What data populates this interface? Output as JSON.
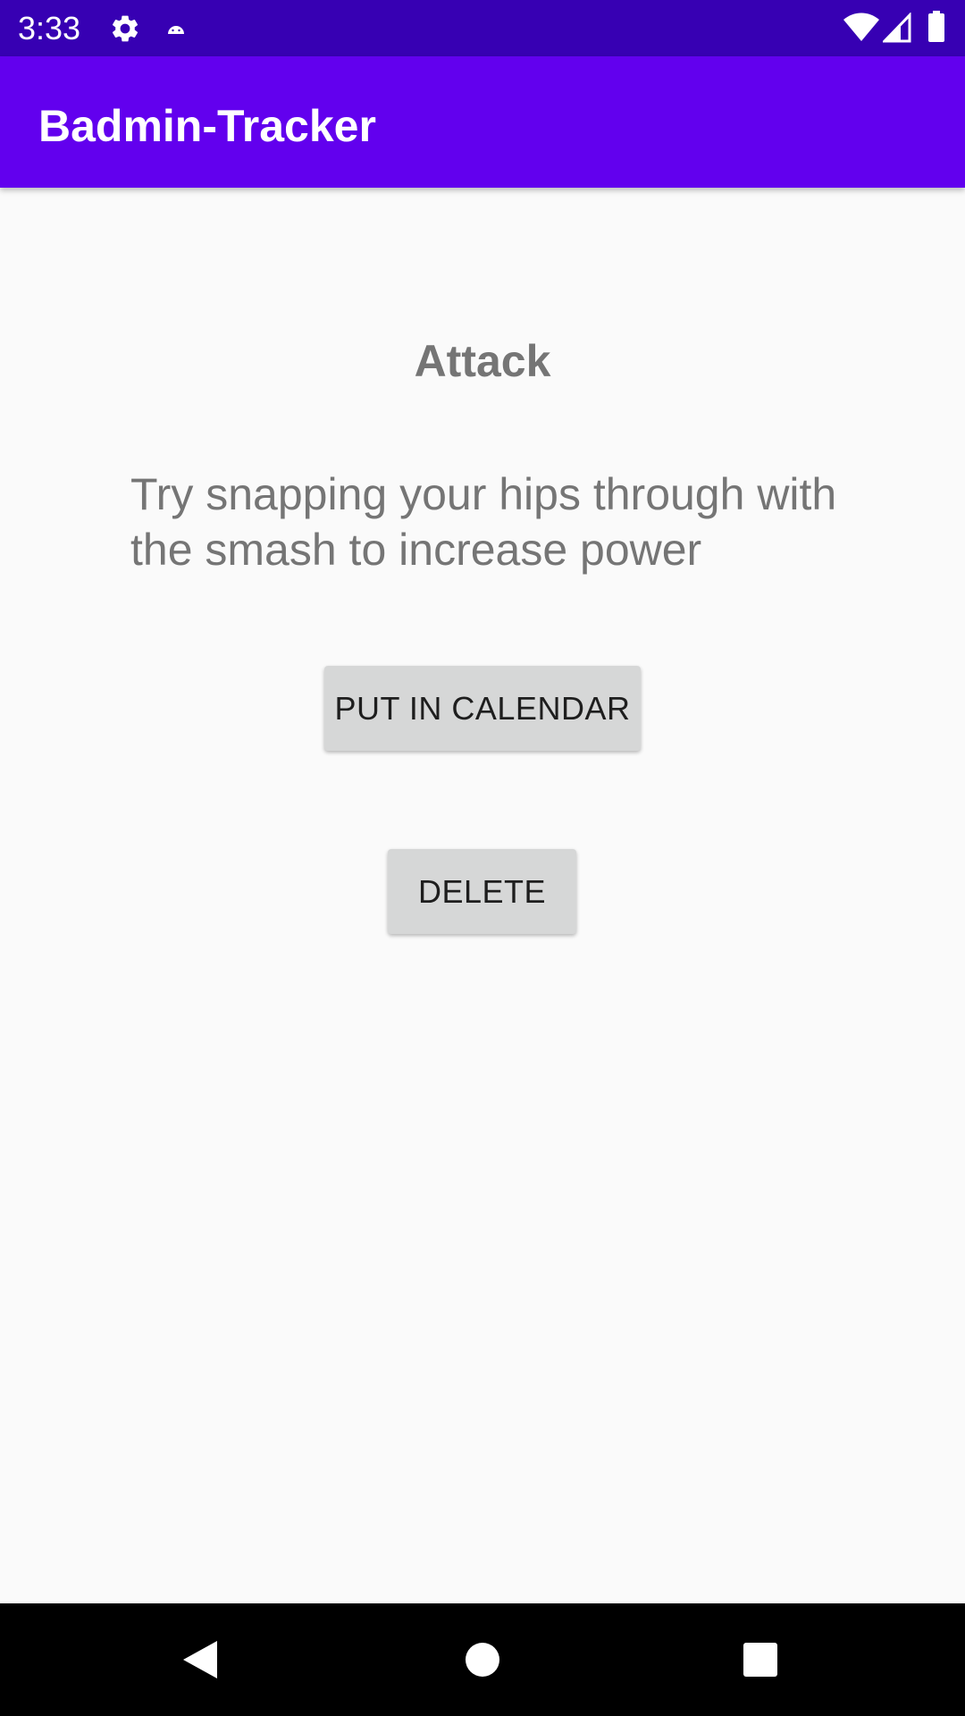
{
  "status_bar": {
    "time": "3:33",
    "icons": [
      "gear-icon",
      "android-icon",
      "wifi-icon",
      "signal-icon",
      "battery-icon"
    ]
  },
  "app_bar": {
    "title": "Badmin-Tracker"
  },
  "content": {
    "title": "Attack",
    "tip": "Try snapping your hips through with the smash to increase power"
  },
  "buttons": {
    "calendar_label": "PUT IN CALENDAR",
    "delete_label": "DELETE"
  },
  "nav_bar": {
    "icons": [
      "back-icon",
      "home-icon",
      "recents-icon"
    ]
  },
  "colors": {
    "status_bar": "#3700b3",
    "app_bar": "#6200ee",
    "background": "#fafafa",
    "button": "#d6d7d7",
    "text_secondary": "#757575"
  }
}
